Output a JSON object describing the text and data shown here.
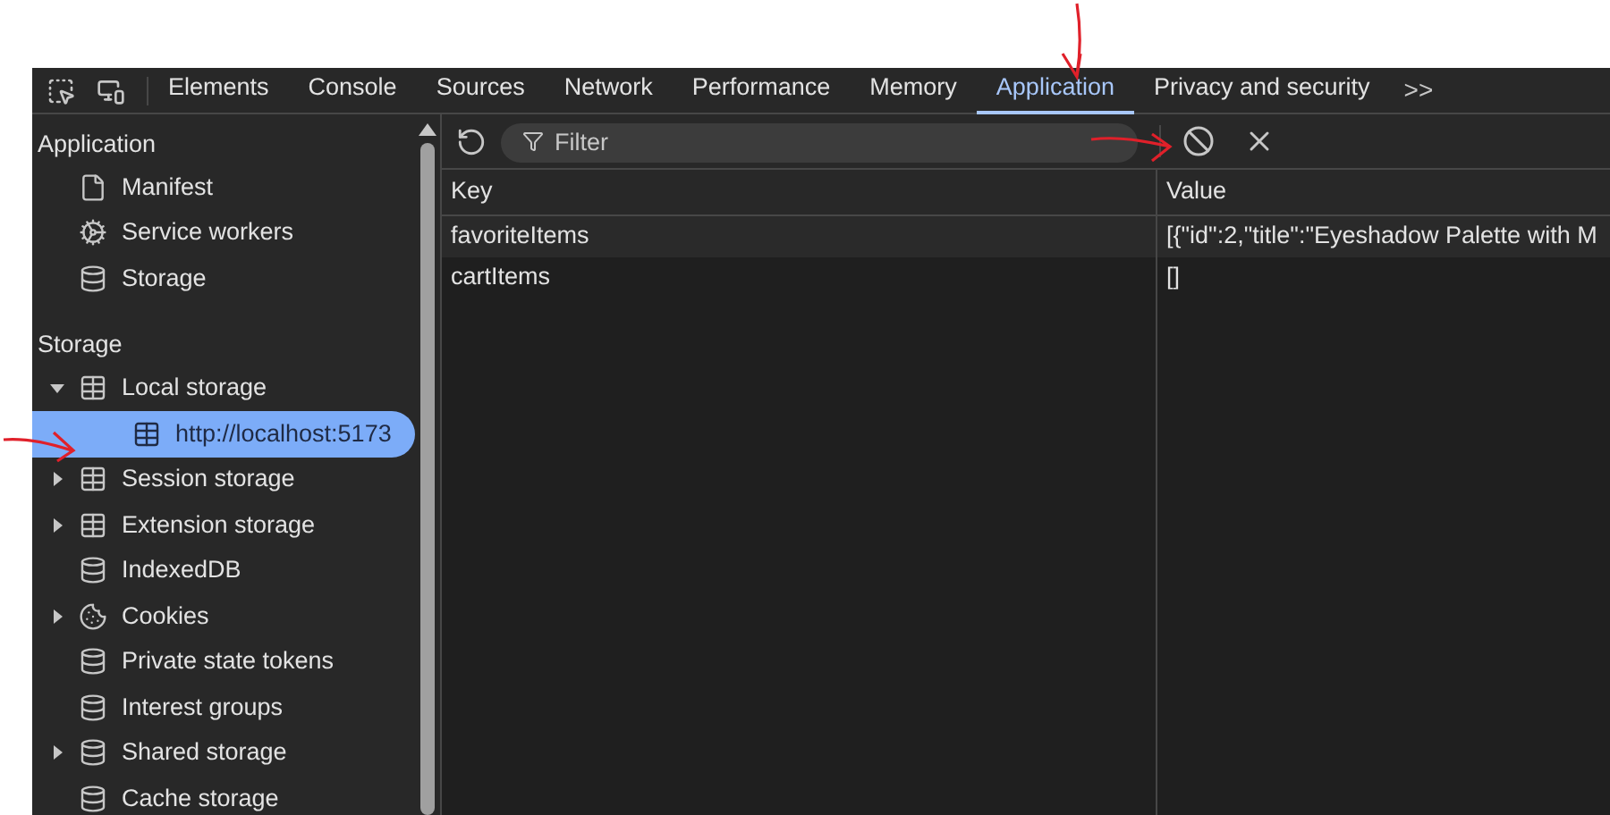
{
  "tabs": [
    {
      "label": "Elements",
      "selected": false
    },
    {
      "label": "Console",
      "selected": false
    },
    {
      "label": "Sources",
      "selected": false
    },
    {
      "label": "Network",
      "selected": false
    },
    {
      "label": "Performance",
      "selected": false
    },
    {
      "label": "Memory",
      "selected": false
    },
    {
      "label": "Application",
      "selected": true
    },
    {
      "label": "Privacy and security",
      "selected": false
    }
  ],
  "more_tabs": ">>",
  "sidebar": {
    "sections": [
      {
        "title": "Application",
        "items": [
          {
            "label": "Manifest",
            "kind": "file",
            "selected": false
          },
          {
            "label": "Service workers",
            "kind": "gear",
            "selected": false
          },
          {
            "label": "Storage",
            "kind": "database",
            "selected": false
          }
        ]
      },
      {
        "title": "Storage",
        "items": [
          {
            "label": "Local storage",
            "kind": "table",
            "expanded": true,
            "selected": false,
            "children": [
              {
                "label": "http://localhost:5173",
                "kind": "table",
                "selected": true
              }
            ]
          },
          {
            "label": "Session storage",
            "kind": "table",
            "expanded": false,
            "selected": false
          },
          {
            "label": "Extension storage",
            "kind": "table",
            "expanded": false,
            "selected": false
          },
          {
            "label": "IndexedDB",
            "kind": "database",
            "selected": false
          },
          {
            "label": "Cookies",
            "kind": "cookie",
            "expanded": false,
            "selected": false
          },
          {
            "label": "Private state tokens",
            "kind": "database",
            "selected": false
          },
          {
            "label": "Interest groups",
            "kind": "database",
            "selected": false
          },
          {
            "label": "Shared storage",
            "kind": "database",
            "expanded": false,
            "selected": false
          },
          {
            "label": "Cache storage",
            "kind": "database",
            "selected": false
          }
        ]
      }
    ]
  },
  "toolbar": {
    "filter": {
      "placeholder": "Filter"
    }
  },
  "table": {
    "columns": [
      "Key",
      "Value"
    ],
    "rows": [
      {
        "key": "favoriteItems",
        "value": "[{\"id\":2,\"title\":\"Eyeshadow Palette with M"
      },
      {
        "key": "cartItems",
        "value": "[]"
      }
    ]
  },
  "annotations": [
    {
      "kind": "arrow-down"
    },
    {
      "kind": "arrow-right-toolbar"
    },
    {
      "kind": "arrow-right-sidebar"
    }
  ]
}
